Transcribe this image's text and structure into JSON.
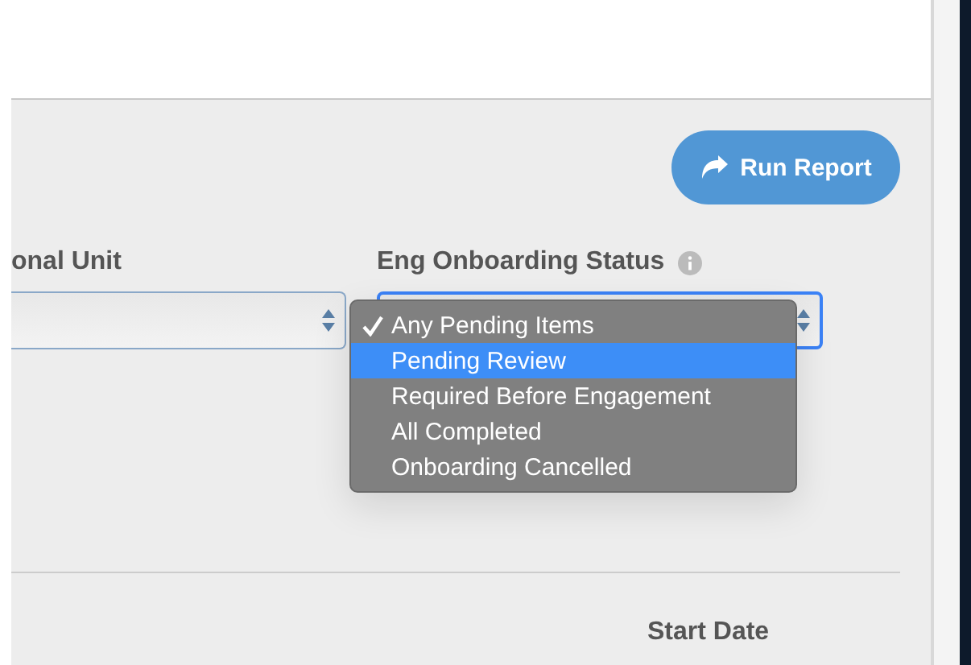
{
  "report_button": {
    "label": "Run Report"
  },
  "filters": [
    {
      "label": "onal Unit",
      "info": false,
      "focused": false
    },
    {
      "label": "Eng Onboarding Status",
      "info": true,
      "focused": true
    }
  ],
  "dropdown": {
    "options": [
      {
        "label": "Any Pending Items",
        "checked": true,
        "selected": false
      },
      {
        "label": "Pending Review",
        "checked": false,
        "selected": true
      },
      {
        "label": "Required Before Engagement",
        "checked": false,
        "selected": false
      },
      {
        "label": "All Completed",
        "checked": false,
        "selected": false
      },
      {
        "label": "Onboarding Cancelled",
        "checked": false,
        "selected": false
      }
    ]
  },
  "table": {
    "columns": [
      "Start Date"
    ]
  }
}
